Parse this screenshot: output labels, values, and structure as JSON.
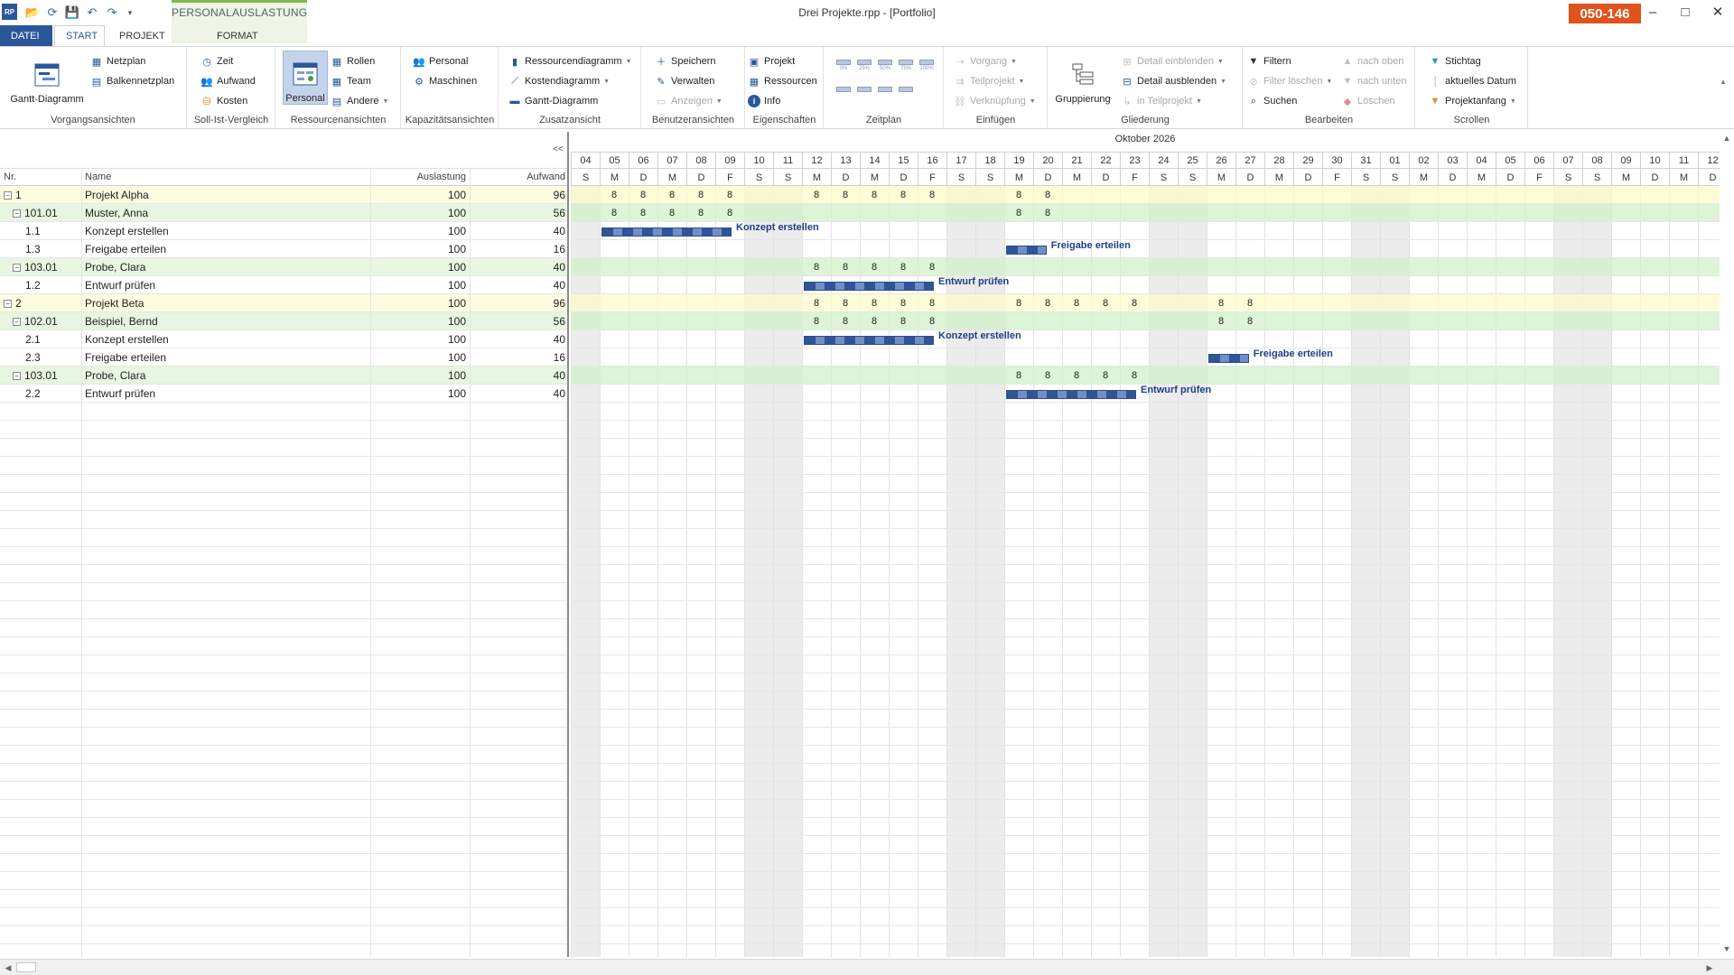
{
  "app": {
    "window_title": "Drei Projekte.rpp - [Portfolio]",
    "license_badge": "050-146",
    "context_group": "PERSONALAUSLASTUNG",
    "logo_text": "RP",
    "win_controls": {
      "minimize": "–",
      "maximize": "□",
      "close": "✕"
    }
  },
  "quick_access": [
    "open-icon",
    "refresh-icon",
    "save-icon",
    "undo-icon",
    "redo-icon",
    "customize-icon"
  ],
  "tabs": [
    {
      "label": "DATEI",
      "kind": "file"
    },
    {
      "label": "START",
      "kind": "active"
    },
    {
      "label": "PROJEKT",
      "kind": "normal"
    },
    {
      "label": "FORMAT",
      "kind": "context"
    }
  ],
  "ribbon": {
    "vorgangsansichten": {
      "label": "Vorgangsansichten",
      "gantt": "Gantt-Diagramm",
      "netzplan": "Netzplan",
      "balkennetzplan": "Balkennetzplan"
    },
    "soll_ist": {
      "label": "Soll-Ist-Vergleich",
      "zeit": "Zeit",
      "aufwand": "Aufwand",
      "kosten": "Kosten"
    },
    "ressourcenansichten": {
      "label": "Ressourcenansichten",
      "personal": "Personal",
      "rollen": "Rollen",
      "team": "Team",
      "andere": "Andere"
    },
    "kapazitaet": {
      "label": "Kapazitätsansichten",
      "personal": "Personal",
      "maschinen": "Maschinen"
    },
    "zusatz": {
      "label": "Zusatzansicht",
      "ressourcendiagramm": "Ressourcendiagramm",
      "kostendiagramm": "Kostendiagramm",
      "gantt": "Gantt-Diagramm"
    },
    "benutzer": {
      "label": "Benutzeransichten",
      "speichern": "Speichern",
      "verwalten": "Verwalten",
      "anzeigen": "Anzeigen"
    },
    "eigenschaften": {
      "label": "Eigenschaften",
      "projekt": "Projekt",
      "ressourcen": "Ressourcen",
      "info": "Info"
    },
    "zeitplan": {
      "label": "Zeitplan",
      "pcts": [
        "0%",
        "25%",
        "50%",
        "75%",
        "100%"
      ]
    },
    "einfuegen": {
      "label": "Einfügen",
      "vorgang": "Vorgang",
      "teilprojekt": "Teilprojekt",
      "verknuepfung": "Verknüpfung"
    },
    "gliederung": {
      "label": "Gliederung",
      "gruppierung": "Gruppierung",
      "detail_ein": "Detail einblenden",
      "detail_aus": "Detail ausblenden",
      "in_teilprojekt": "in Teilprojekt"
    },
    "bearbeiten": {
      "label": "Bearbeiten",
      "filtern": "Filtern",
      "filter_loeschen": "Filter löschen",
      "suchen": "Suchen",
      "nach_oben": "nach oben",
      "nach_unten": "nach unten",
      "loeschen": "Löschen"
    },
    "scrollen": {
      "label": "Scrollen",
      "stichtag": "Stichtag",
      "aktuelles_datum": "aktuelles Datum",
      "projektanfang": "Projektanfang"
    }
  },
  "grid": {
    "collapse": "<<",
    "headers": {
      "nr": "Nr.",
      "name": "Name",
      "auslastung": "Auslastung",
      "aufwand": "Aufwand"
    },
    "rows": [
      {
        "level": 0,
        "type": "project",
        "expand": "−",
        "nr": "1",
        "name": "Projekt Alpha",
        "auslastung": "100",
        "aufwand": "96"
      },
      {
        "level": 1,
        "type": "resource",
        "expand": "−",
        "nr": "101.01",
        "name": "Muster, Anna",
        "auslastung": "100",
        "aufwand": "56"
      },
      {
        "level": 2,
        "type": "task",
        "expand": "",
        "nr": "1.1",
        "name": "Konzept erstellen",
        "auslastung": "100",
        "aufwand": "40"
      },
      {
        "level": 2,
        "type": "task",
        "expand": "",
        "nr": "1.3",
        "name": "Freigabe erteilen",
        "auslastung": "100",
        "aufwand": "16"
      },
      {
        "level": 1,
        "type": "resource",
        "expand": "−",
        "nr": "103.01",
        "name": "Probe, Clara",
        "auslastung": "100",
        "aufwand": "40"
      },
      {
        "level": 2,
        "type": "task",
        "expand": "",
        "nr": "1.2",
        "name": "Entwurf prüfen",
        "auslastung": "100",
        "aufwand": "40"
      },
      {
        "level": 0,
        "type": "project",
        "expand": "−",
        "nr": "2",
        "name": "Projekt Beta",
        "auslastung": "100",
        "aufwand": "96"
      },
      {
        "level": 1,
        "type": "resource",
        "expand": "−",
        "nr": "102.01",
        "name": "Beispiel, Bernd",
        "auslastung": "100",
        "aufwand": "56"
      },
      {
        "level": 2,
        "type": "task",
        "expand": "",
        "nr": "2.1",
        "name": "Konzept erstellen",
        "auslastung": "100",
        "aufwand": "40"
      },
      {
        "level": 2,
        "type": "task",
        "expand": "",
        "nr": "2.3",
        "name": "Freigabe erteilen",
        "auslastung": "100",
        "aufwand": "16"
      },
      {
        "level": 1,
        "type": "resource",
        "expand": "−",
        "nr": "103.01",
        "name": "Probe, Clara",
        "auslastung": "100",
        "aufwand": "40"
      },
      {
        "level": 2,
        "type": "task",
        "expand": "",
        "nr": "2.2",
        "name": "Entwurf prüfen",
        "auslastung": "100",
        "aufwand": "40"
      }
    ]
  },
  "gantt": {
    "month": "Oktober 2026",
    "days": [
      {
        "d": "04",
        "w": "S"
      },
      {
        "d": "05",
        "w": "M"
      },
      {
        "d": "06",
        "w": "D"
      },
      {
        "d": "07",
        "w": "M"
      },
      {
        "d": "08",
        "w": "D"
      },
      {
        "d": "09",
        "w": "F"
      },
      {
        "d": "10",
        "w": "S"
      },
      {
        "d": "11",
        "w": "S"
      },
      {
        "d": "12",
        "w": "M"
      },
      {
        "d": "13",
        "w": "D"
      },
      {
        "d": "14",
        "w": "M"
      },
      {
        "d": "15",
        "w": "D"
      },
      {
        "d": "16",
        "w": "F"
      },
      {
        "d": "17",
        "w": "S"
      },
      {
        "d": "18",
        "w": "S"
      },
      {
        "d": "19",
        "w": "M"
      },
      {
        "d": "20",
        "w": "D"
      },
      {
        "d": "21",
        "w": "M"
      },
      {
        "d": "22",
        "w": "D"
      },
      {
        "d": "23",
        "w": "F"
      },
      {
        "d": "24",
        "w": "S"
      },
      {
        "d": "25",
        "w": "S"
      },
      {
        "d": "26",
        "w": "M"
      },
      {
        "d": "27",
        "w": "D"
      },
      {
        "d": "28",
        "w": "M"
      },
      {
        "d": "29",
        "w": "D"
      },
      {
        "d": "30",
        "w": "F"
      },
      {
        "d": "31",
        "w": "S"
      },
      {
        "d": "01",
        "w": "S"
      },
      {
        "d": "02",
        "w": "M"
      },
      {
        "d": "03",
        "w": "D"
      },
      {
        "d": "04",
        "w": "M"
      },
      {
        "d": "05",
        "w": "D"
      },
      {
        "d": "06",
        "w": "F"
      },
      {
        "d": "07",
        "w": "S"
      },
      {
        "d": "08",
        "w": "S"
      },
      {
        "d": "09",
        "w": "M"
      },
      {
        "d": "10",
        "w": "D"
      },
      {
        "d": "11",
        "w": "M"
      },
      {
        "d": "12",
        "w": "D"
      }
    ],
    "loads": [
      [
        "",
        "8",
        "8",
        "8",
        "8",
        "8",
        "",
        "",
        "8",
        "8",
        "8",
        "8",
        "8",
        "",
        "",
        "8",
        "8"
      ],
      [
        "",
        "8",
        "8",
        "8",
        "8",
        "8",
        "",
        "",
        "",
        "",
        "",
        "",
        "",
        "",
        "",
        "8",
        "8"
      ],
      [],
      [],
      [
        "",
        "",
        "",
        "",
        "",
        "",
        "",
        "",
        "8",
        "8",
        "8",
        "8",
        "8"
      ],
      [],
      [
        "",
        "",
        "",
        "",
        "",
        "",
        "",
        "",
        "8",
        "8",
        "8",
        "8",
        "8",
        "",
        "",
        "8",
        "8",
        "8",
        "8",
        "8",
        "",
        "",
        "8",
        "8"
      ],
      [
        "",
        "",
        "",
        "",
        "",
        "",
        "",
        "",
        "8",
        "8",
        "8",
        "8",
        "8",
        "",
        "",
        "",
        "",
        "",
        "",
        "",
        "",
        "",
        "8",
        "8"
      ],
      [],
      [],
      [
        "",
        "",
        "",
        "",
        "",
        "",
        "",
        "",
        "",
        "",
        "",
        "",
        "",
        "",
        "",
        "8",
        "8",
        "8",
        "8",
        "8"
      ],
      []
    ],
    "bars": [
      {
        "row": 2,
        "start": 1,
        "days": 4.5,
        "label": "Konzept erstellen"
      },
      {
        "row": 3,
        "start": 15,
        "days": 1.4,
        "label": "Freigabe erteilen"
      },
      {
        "row": 5,
        "start": 8,
        "days": 4.5,
        "label": "Entwurf prüfen"
      },
      {
        "row": 8,
        "start": 8,
        "days": 4.5,
        "label": "Konzept erstellen"
      },
      {
        "row": 9,
        "start": 22,
        "days": 1.4,
        "label": "Freigabe erteilen"
      },
      {
        "row": 11,
        "start": 15,
        "days": 4.5,
        "label": "Entwurf prüfen"
      }
    ]
  }
}
